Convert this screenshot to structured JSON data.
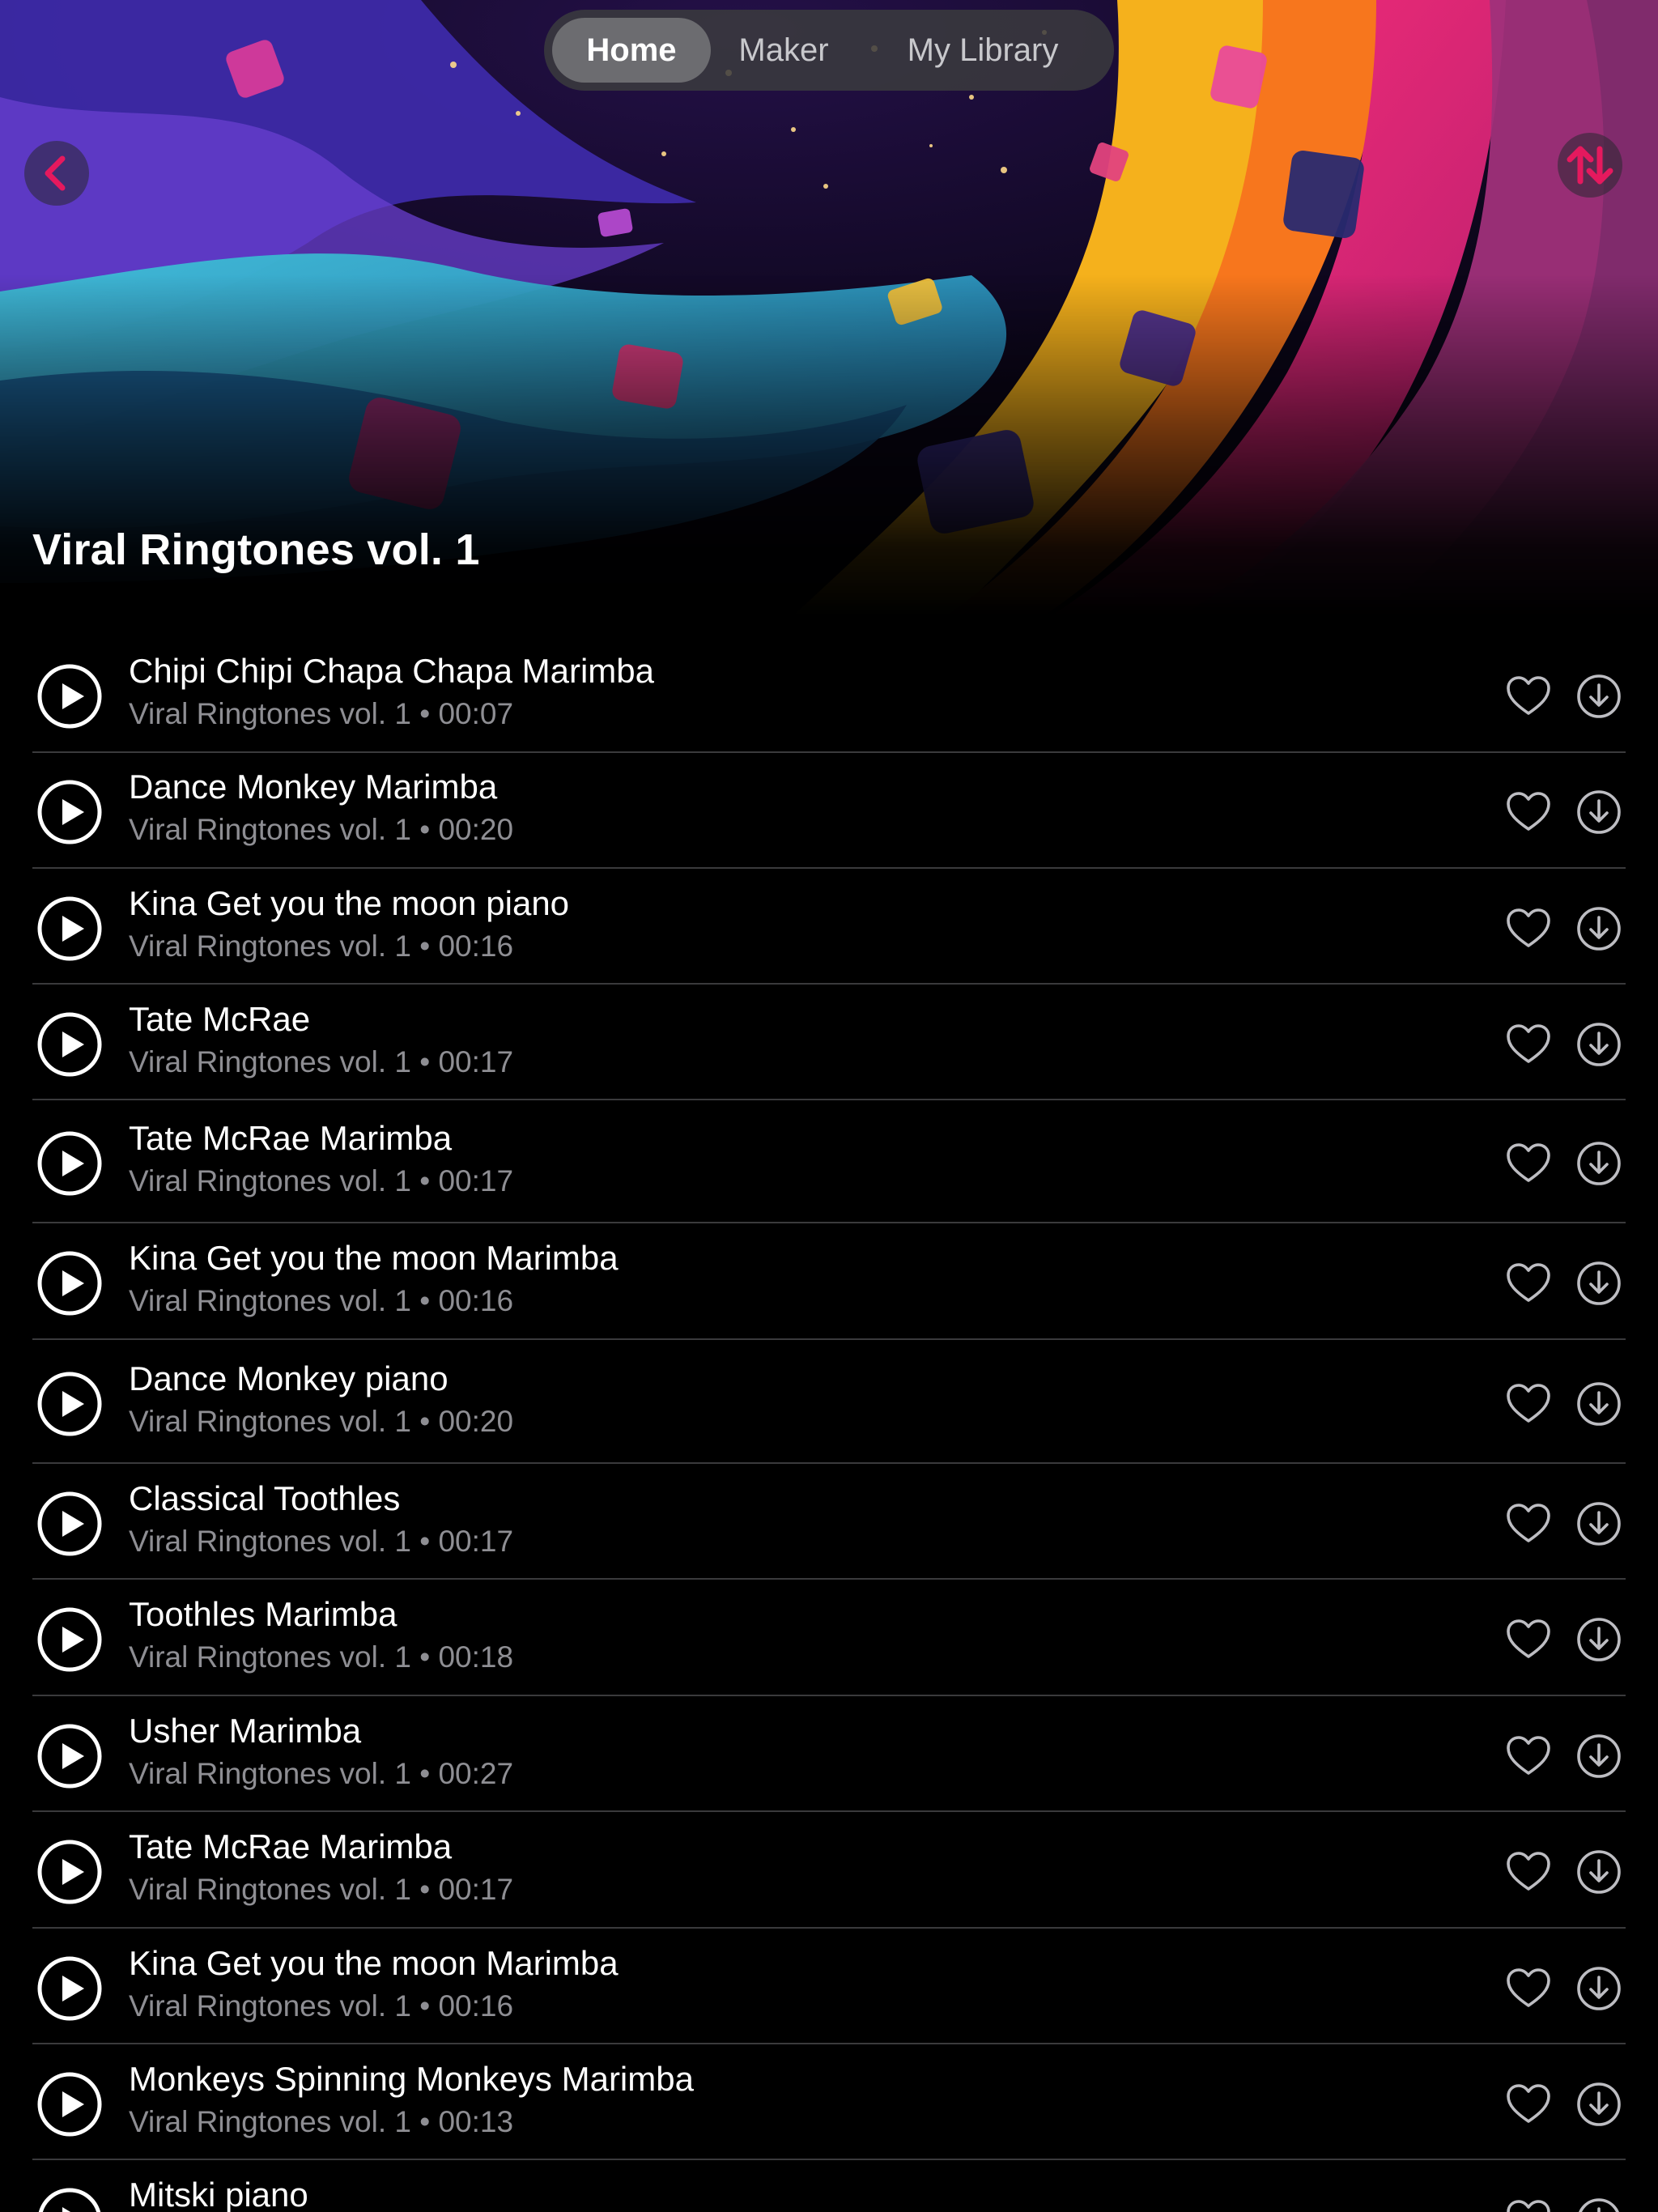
{
  "nav": {
    "tabs": [
      {
        "label": "Home",
        "active": true
      },
      {
        "label": "Maker",
        "active": false
      },
      {
        "label": "My Library",
        "active": false
      }
    ]
  },
  "hero": {
    "title": "Viral Ringtones vol. 1",
    "back_icon": "chevron-left-icon",
    "sort_icon": "sort-arrows-icon"
  },
  "colors": {
    "accent": "#e5195e",
    "background": "#000000",
    "secondary_text": "#8e8e93",
    "divider": "#3a3a3c"
  },
  "tracks": [
    {
      "title": "Chipi Chipi Chapa Chapa Marimba",
      "subtitle": "Viral Ringtones vol. 1 • 00:07"
    },
    {
      "title": "Dance Monkey Marimba",
      "subtitle": "Viral Ringtones vol. 1 • 00:20"
    },
    {
      "title": "Kina Get you the moon piano",
      "subtitle": "Viral Ringtones vol. 1 • 00:16"
    },
    {
      "title": "Tate McRae",
      "subtitle": "Viral Ringtones vol. 1 • 00:17"
    },
    {
      "title": "Tate McRae Marimba",
      "subtitle": "Viral Ringtones vol. 1 • 00:17"
    },
    {
      "title": "Kina Get you the moon Marimba",
      "subtitle": "Viral Ringtones vol. 1 • 00:16"
    },
    {
      "title": "Dance Monkey piano",
      "subtitle": "Viral Ringtones vol. 1 • 00:20"
    },
    {
      "title": "Classical Toothles",
      "subtitle": "Viral Ringtones vol. 1 • 00:17"
    },
    {
      "title": "Toothles Marimba",
      "subtitle": "Viral Ringtones vol. 1 • 00:18"
    },
    {
      "title": "Usher Marimba",
      "subtitle": "Viral Ringtones vol. 1 • 00:27"
    },
    {
      "title": "Tate McRae Marimba",
      "subtitle": "Viral Ringtones vol. 1 • 00:17"
    },
    {
      "title": "Kina Get you the moon Marimba",
      "subtitle": "Viral Ringtones vol. 1 • 00:16"
    },
    {
      "title": "Monkeys Spinning Monkeys Marimba",
      "subtitle": "Viral Ringtones vol. 1 • 00:13"
    },
    {
      "title": "Mitski piano",
      "subtitle": ""
    }
  ],
  "row_icons": {
    "play": "play-circle-icon",
    "favorite": "heart-icon",
    "download": "download-circle-icon"
  }
}
